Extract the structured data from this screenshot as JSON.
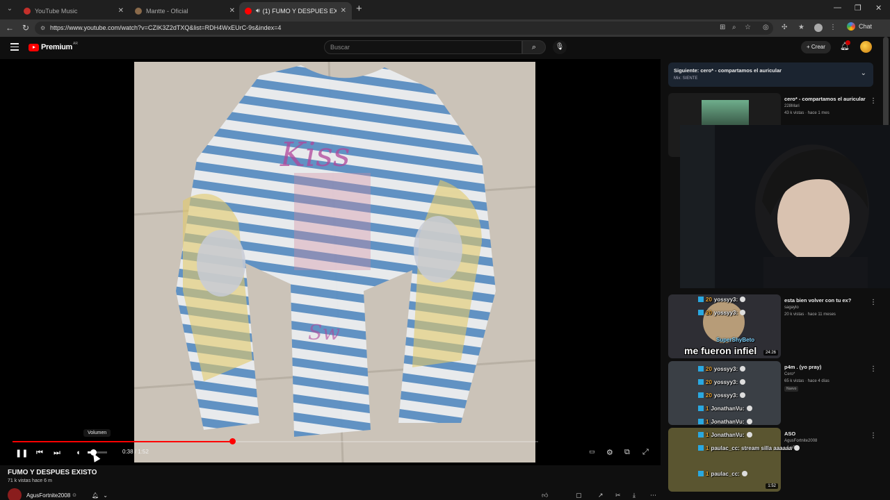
{
  "browser": {
    "tabs": [
      {
        "label": "YouTube Music",
        "favicon": "#c4302b"
      },
      {
        "label": "Mantte - Oficial",
        "favicon": "#8a6a4a"
      },
      {
        "label": "(1) FUMO Y DESPUES EXISTO",
        "favicon": "#ff0000",
        "audio": "speaker-icon"
      }
    ],
    "url": "https://www.youtube.com/watch?v=CZIK3Z2dTXQ&list=RDH4WxEUrC-9s&index=4",
    "chat_label": "Chat"
  },
  "youtube": {
    "logo_text": "Premium",
    "logo_country": "AR",
    "search_placeholder": "Buscar",
    "crear_label": "Crear"
  },
  "player": {
    "progress_fraction": 0.418,
    "volume_fraction": 0.3,
    "time": "0:38 / 1:52",
    "tooltip": "Volumen"
  },
  "video": {
    "title": "FUMO Y DESPUES EXISTO",
    "meta": "71 k vistas  hace 6 m",
    "channel": "AgusFortnite2008"
  },
  "sidebar": {
    "next_title": "Siguiente: cero* - compartamos el auricular",
    "next_channel": "Mix: SIENTE",
    "items": [
      {
        "title": "cero* - compartamos el auricular",
        "channel": "228Mari",
        "stats": "43 k vistas · hace 1 mes",
        "badge": ""
      },
      {
        "title": "esta bien volver con tu ex?",
        "channel": "sagaylo",
        "stats": "20 k vistas · hace 11 meses",
        "badge": "",
        "duration": "24:26"
      },
      {
        "title": "p4m .          (yo   pray)",
        "channel": "Cero*",
        "stats": "65 k vistas · hace 4 días",
        "badge": "Nuevo"
      },
      {
        "title": "ASO",
        "channel": "AgusFortnite2008",
        "stats": "· 1 año",
        "badge": "",
        "duration": "1:52"
      }
    ]
  },
  "overlay": {
    "chat": [
      {
        "num": "20",
        "user": "yossyy3:"
      },
      {
        "num": "20",
        "user": "yossyy3:"
      },
      {
        "num": "20",
        "user": "yossyy3:"
      },
      {
        "num": "20",
        "user": "yossyy3:"
      },
      {
        "num": "20",
        "user": "yossyy3:"
      },
      {
        "num": "1",
        "user": "JonathanVu:"
      },
      {
        "num": "1",
        "user": "JonathanVu:"
      },
      {
        "num": "1",
        "user": "JonathanVu:"
      },
      {
        "num": "1",
        "user": "paulac_cc: stream silla aaaaaa"
      },
      {
        "num": "1",
        "user": "paulac_cc:"
      }
    ],
    "meme": "me fueron infiel",
    "super": "SuperShyBeto"
  }
}
